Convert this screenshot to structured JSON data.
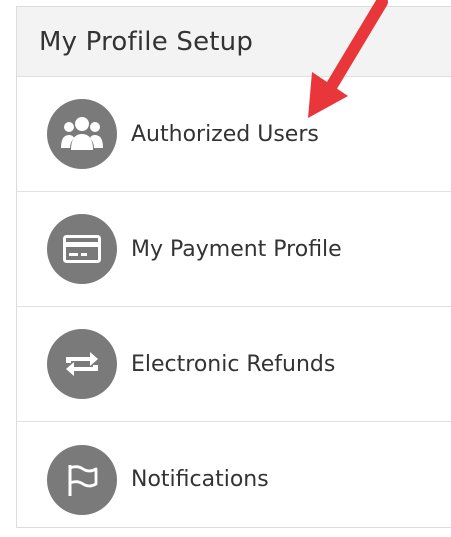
{
  "panel": {
    "title": "My Profile Setup"
  },
  "menu": {
    "items": [
      {
        "label": "Authorized Users",
        "icon": "users-icon"
      },
      {
        "label": "My Payment Profile",
        "icon": "credit-card-icon"
      },
      {
        "label": "Electronic Refunds",
        "icon": "refresh-arrows-icon"
      },
      {
        "label": "Notifications",
        "icon": "flag-icon"
      }
    ]
  },
  "colors": {
    "icon_circle": "#7a7a7a",
    "annotation_arrow": "#e8363a",
    "header_bg": "#f3f3f3"
  }
}
